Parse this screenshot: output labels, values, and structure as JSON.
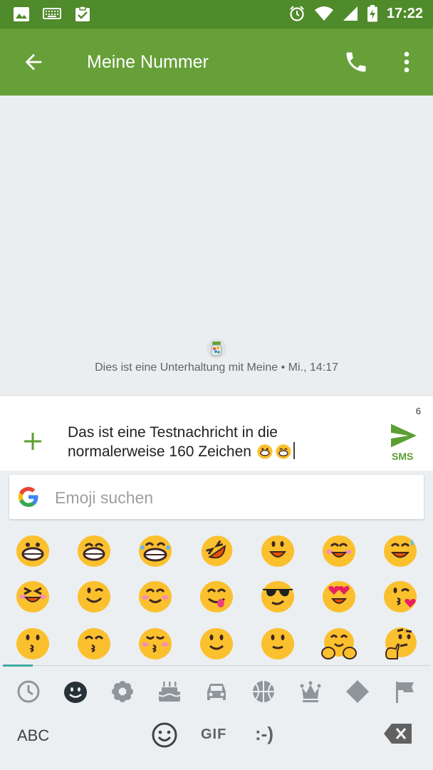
{
  "statusbar": {
    "time": "17:22"
  },
  "toolbar": {
    "title": "Meine Nummer"
  },
  "conversation": {
    "info": "Dies ist eine Unterhaltung mit Meine • Mi., 14:17"
  },
  "compose": {
    "char_count": "6",
    "message": "Das ist eine Testnachricht in die normalerweise 160 Zeichen",
    "message_emojis": [
      "grinning-face",
      "grinning-face-with-smiling-eyes"
    ],
    "send_label": "SMS"
  },
  "keyboard": {
    "search_placeholder": "Emoji suchen",
    "emoji_rows": [
      [
        "grinning-face",
        "grinning-face-with-smiling-eyes",
        "grinning-squinting-face",
        "rolling-on-the-floor-laughing",
        "smiling-face-with-open-mouth",
        "smiling-face-with-smiling-eyes-open-mouth",
        "grinning-face-with-sweat"
      ],
      [
        "squinting-face-with-open-mouth",
        "winking-face",
        "smiling-face-with-smiling-eyes",
        "face-savoring-food",
        "smiling-face-with-sunglasses",
        "smiling-face-with-heart-eyes",
        "face-blowing-a-kiss"
      ],
      [
        "kissing-face",
        "kissing-face-with-smiling-eyes",
        "kissing-face-with-closed-eyes",
        "slightly-smiling-face",
        "slightly-smiling-face-2",
        "hugging-face",
        "thinking-face"
      ]
    ],
    "categories": [
      "recent-icon",
      "smileys-icon",
      "nature-icon",
      "food-icon",
      "travel-icon",
      "activities-icon",
      "objects-icon",
      "symbols-icon",
      "flags-icon"
    ],
    "bottom": {
      "abc": "ABC",
      "gif": "GIF",
      "emoticon": ":-)"
    },
    "accent_color": "#3fa8a0"
  },
  "colors": {
    "statusbar": "#4f8a2b",
    "appbar": "#679f39",
    "send": "#5b9e33"
  }
}
